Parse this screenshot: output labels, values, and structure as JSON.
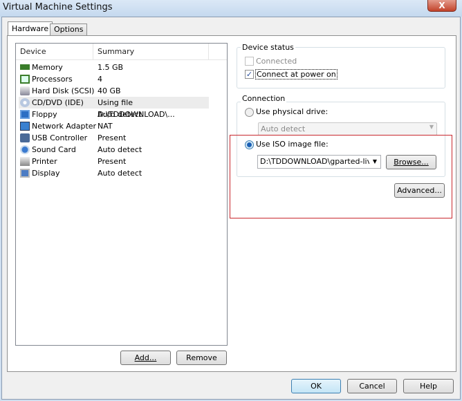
{
  "window": {
    "title": "Virtual Machine Settings",
    "close_label": "X"
  },
  "tabs": [
    {
      "label": "Hardware"
    },
    {
      "label": "Options"
    }
  ],
  "device_list": {
    "headers": [
      "Device",
      "Summary"
    ],
    "rows": [
      {
        "device": "Memory",
        "summary": "1.5 GB",
        "icon": "memory-icon"
      },
      {
        "device": "Processors",
        "summary": "4",
        "icon": "processor-icon"
      },
      {
        "device": "Hard Disk (SCSI)",
        "summary": "40 GB",
        "icon": "hard-disk-icon"
      },
      {
        "device": "CD/DVD (IDE)",
        "summary": "Using file D:\\TDDOWNLOAD\\...",
        "icon": "cd-dvd-icon"
      },
      {
        "device": "Floppy",
        "summary": "Auto detect",
        "icon": "floppy-icon"
      },
      {
        "device": "Network Adapter",
        "summary": "NAT",
        "icon": "network-adapter-icon"
      },
      {
        "device": "USB Controller",
        "summary": "Present",
        "icon": "usb-icon"
      },
      {
        "device": "Sound Card",
        "summary": "Auto detect",
        "icon": "sound-card-icon"
      },
      {
        "device": "Printer",
        "summary": "Present",
        "icon": "printer-icon"
      },
      {
        "device": "Display",
        "summary": "Auto detect",
        "icon": "display-icon"
      }
    ],
    "selected_index": 3
  },
  "buttons": {
    "add": "Add...",
    "remove": "Remove",
    "ok": "OK",
    "cancel": "Cancel",
    "help": "Help",
    "browse": "Browse...",
    "advanced": "Advanced..."
  },
  "device_status": {
    "title": "Device status",
    "connected": "Connected",
    "connected_checked": false,
    "connect_power_on": "Connect at power on",
    "connect_power_on_checked": true
  },
  "connection": {
    "title": "Connection",
    "physical_label": "Use physical drive:",
    "physical_value": "Auto detect",
    "iso_label": "Use ISO image file:",
    "iso_value": "D:\\TDDOWNLOAD\\gparted-live-(",
    "selected": "iso"
  },
  "colors": {
    "highlight_box": "#c8282d"
  }
}
